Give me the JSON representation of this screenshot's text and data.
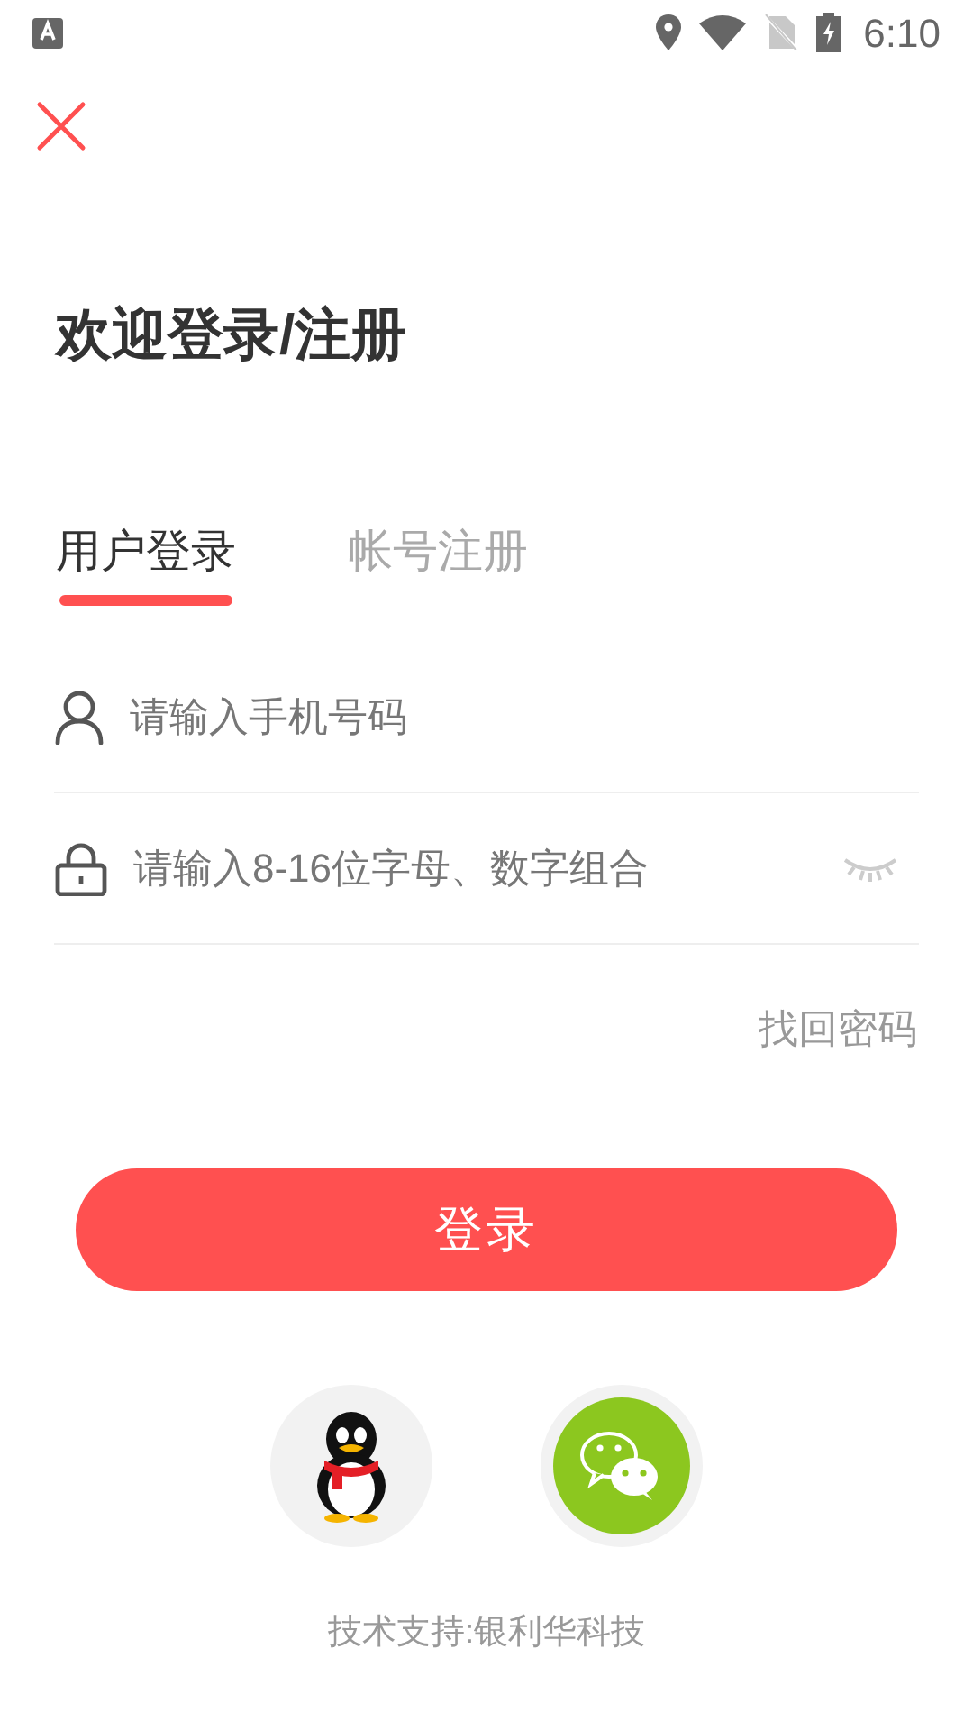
{
  "status_bar": {
    "time": "6:10"
  },
  "title": "欢迎登录/注册",
  "tabs": [
    {
      "label": "用户登录",
      "selected": true
    },
    {
      "label": "帐号注册",
      "selected": false
    }
  ],
  "fields": [
    {
      "kind": "phone",
      "placeholder": "请输入手机号码"
    },
    {
      "kind": "password",
      "placeholder": "请输入8-16位字母、数字组合"
    }
  ],
  "forgot_link": "找回密码",
  "login_button": "登录",
  "social": [
    {
      "kind": "qq"
    },
    {
      "kind": "wechat"
    }
  ],
  "footer": "技术支持:银利华科技"
}
